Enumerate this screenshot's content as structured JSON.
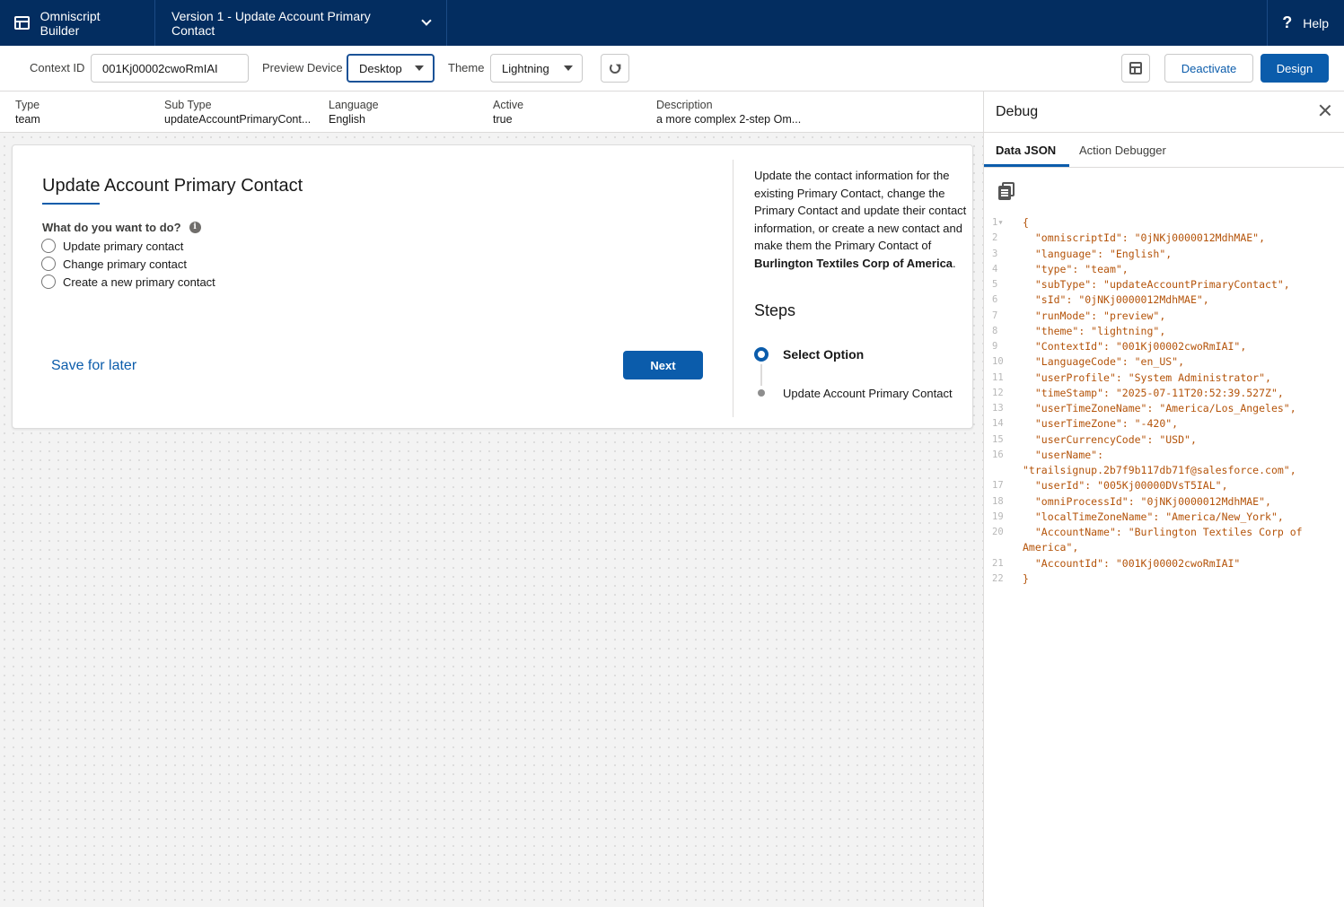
{
  "topbar": {
    "app_title": "Omniscript Builder",
    "version_label": "Version 1 - Update Account Primary Contact",
    "help_label": "Help"
  },
  "toolbar": {
    "context_id_label": "Context ID",
    "context_id_value": "001Kj00002cwoRmIAI",
    "preview_device_label": "Preview Device",
    "preview_device_value": "Desktop",
    "theme_label": "Theme",
    "theme_value": "Lightning",
    "deactivate_label": "Deactivate",
    "design_label": "Design"
  },
  "info": {
    "columns": [
      {
        "label": "Type",
        "value": "team"
      },
      {
        "label": "Sub Type",
        "value": "updateAccountPrimaryCont..."
      },
      {
        "label": "Language",
        "value": "English"
      },
      {
        "label": "Active",
        "value": "true"
      },
      {
        "label": "Description",
        "value": "a more complex 2-step Om..."
      }
    ]
  },
  "form": {
    "title": "Update Account Primary Contact",
    "question": "What do you want to do?",
    "options": [
      "Update primary contact",
      "Change primary contact",
      "Create a new primary contact"
    ],
    "save_for_later": "Save for later",
    "next": "Next",
    "description_prefix": "Update the contact information for the existing Primary Contact, change the Primary Contact and update their contact information, or create a new contact and make them the Primary Contact of ",
    "description_account": "Burlington Textiles Corp of America",
    "description_suffix": ".",
    "steps_title": "Steps",
    "steps": [
      "Select Option",
      "Update Account Primary Contact"
    ]
  },
  "debug": {
    "title": "Debug",
    "tabs": [
      "Data JSON",
      "Action Debugger"
    ],
    "json_lines": [
      {
        "n": "1▾",
        "t": "{"
      },
      {
        "n": "2",
        "t": "  \"omniscriptId\": \"0jNKj0000012MdhMAE\","
      },
      {
        "n": "3",
        "t": "  \"language\": \"English\","
      },
      {
        "n": "4",
        "t": "  \"type\": \"team\","
      },
      {
        "n": "5",
        "t": "  \"subType\": \"updateAccountPrimaryContact\","
      },
      {
        "n": "6",
        "t": "  \"sId\": \"0jNKj0000012MdhMAE\","
      },
      {
        "n": "7",
        "t": "  \"runMode\": \"preview\","
      },
      {
        "n": "8",
        "t": "  \"theme\": \"lightning\","
      },
      {
        "n": "9",
        "t": "  \"ContextId\": \"001Kj00002cwoRmIAI\","
      },
      {
        "n": "10",
        "t": "  \"LanguageCode\": \"en_US\","
      },
      {
        "n": "11",
        "t": "  \"userProfile\": \"System Administrator\","
      },
      {
        "n": "12",
        "t": "  \"timeStamp\": \"2025-07-11T20:52:39.527Z\","
      },
      {
        "n": "13",
        "t": "  \"userTimeZoneName\": \"America/Los_Angeles\","
      },
      {
        "n": "14",
        "t": "  \"userTimeZone\": \"-420\","
      },
      {
        "n": "15",
        "t": "  \"userCurrencyCode\": \"USD\","
      },
      {
        "n": "16",
        "t": "  \"userName\":\n\"trailsignup.2b7f9b117db71f@salesforce.com\","
      },
      {
        "n": "17",
        "t": "  \"userId\": \"005Kj00000DVsT5IAL\","
      },
      {
        "n": "18",
        "t": "  \"omniProcessId\": \"0jNKj0000012MdhMAE\","
      },
      {
        "n": "19",
        "t": "  \"localTimeZoneName\": \"America/New_York\","
      },
      {
        "n": "20",
        "t": "  \"AccountName\": \"Burlington Textiles Corp of\nAmerica\","
      },
      {
        "n": "21",
        "t": "  \"AccountId\": \"001Kj00002cwoRmIAI\""
      },
      {
        "n": "22",
        "t": "}"
      }
    ]
  }
}
